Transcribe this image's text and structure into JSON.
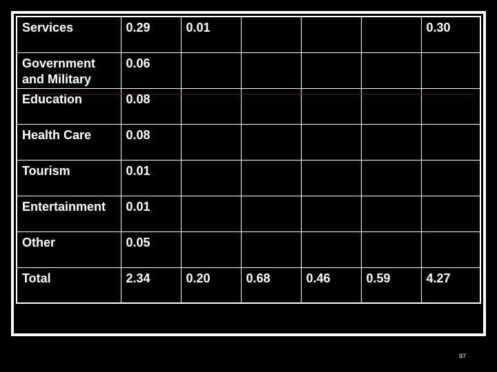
{
  "slide": {
    "page_number": "97"
  },
  "table": {
    "rows": [
      {
        "label": "Services",
        "values": [
          "0.29",
          "0.01",
          "",
          "",
          "",
          "0.30"
        ]
      },
      {
        "label": "Government and Military",
        "values": [
          "0.06",
          "",
          "",
          "",
          "",
          ""
        ]
      },
      {
        "label": "Education",
        "values": [
          "0.08",
          "",
          "",
          "",
          "",
          ""
        ]
      },
      {
        "label": "Health Care",
        "values": [
          "0.08",
          "",
          "",
          "",
          "",
          ""
        ]
      },
      {
        "label": "Tourism",
        "values": [
          "0.01",
          "",
          "",
          "",
          "",
          ""
        ]
      },
      {
        "label": "Entertainment",
        "values": [
          "0.01",
          "",
          "",
          "",
          "",
          ""
        ]
      },
      {
        "label": "Other",
        "values": [
          "0.05",
          "",
          "",
          "",
          "",
          ""
        ]
      },
      {
        "label": "Total",
        "values": [
          "2.34",
          "0.20",
          "0.68",
          "0.46",
          "0.59",
          "4.27"
        ]
      }
    ]
  }
}
